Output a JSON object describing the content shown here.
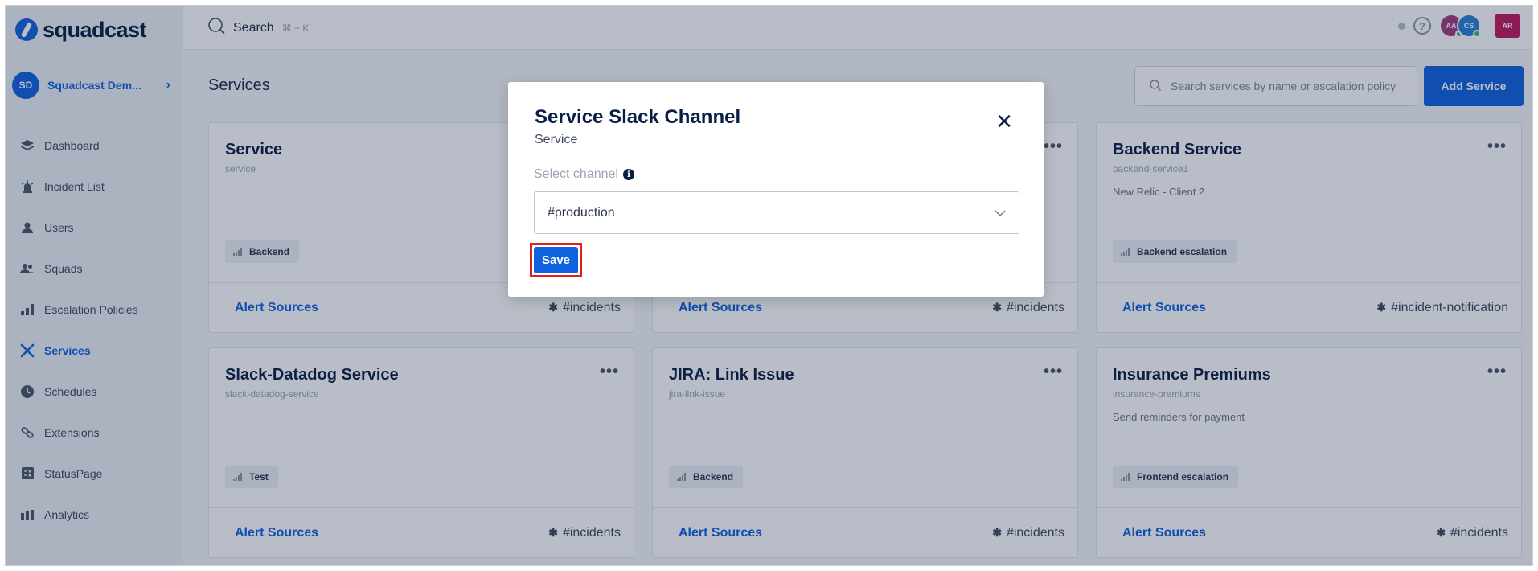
{
  "app": {
    "logo_text": "squadcast"
  },
  "topbar": {
    "search_label": "Search",
    "search_hint": "⌘ + K"
  },
  "org": {
    "initials": "SD",
    "name": "Squadcast Dem..."
  },
  "sidebar": {
    "items": [
      {
        "label": "Dashboard",
        "icon": "layers-icon"
      },
      {
        "label": "Incident List",
        "icon": "siren-icon"
      },
      {
        "label": "Users",
        "icon": "user-icon"
      },
      {
        "label": "Squads",
        "icon": "users-icon"
      },
      {
        "label": "Escalation Policies",
        "icon": "escalation-icon"
      },
      {
        "label": "Services",
        "icon": "services-icon",
        "active": true
      },
      {
        "label": "Schedules",
        "icon": "clock-icon"
      },
      {
        "label": "Extensions",
        "icon": "link-icon"
      },
      {
        "label": "StatusPage",
        "icon": "statuspage-icon"
      },
      {
        "label": "Analytics",
        "icon": "bar-chart-icon"
      }
    ]
  },
  "header": {
    "avatars": [
      "AA",
      "CS"
    ],
    "user_initials": "AR"
  },
  "main": {
    "title": "Services",
    "search_placeholder": "Search services by name or escalation policy",
    "add_button": "Add Service",
    "cards": [
      {
        "title": "Service",
        "slug": "service",
        "desc": "",
        "badge": "Backend",
        "alert_label": "Alert Sources",
        "channel": "#incidents"
      },
      {
        "title": "",
        "slug": "",
        "desc": "",
        "badge": "",
        "alert_label": "Alert Sources",
        "channel": "#incidents"
      },
      {
        "title": "Backend Service",
        "slug": "backend-service1",
        "desc": "New Relic - Client 2",
        "badge": "Backend escalation",
        "alert_label": "Alert Sources",
        "channel": "#incident-notification"
      },
      {
        "title": "Slack-Datadog Service",
        "slug": "slack-datadog-service",
        "desc": "",
        "badge": "Test",
        "alert_label": "Alert Sources",
        "channel": "#incidents"
      },
      {
        "title": "JIRA: Link Issue",
        "slug": "jira-link-issue",
        "desc": "",
        "badge": "Backend",
        "alert_label": "Alert Sources",
        "channel": "#incidents"
      },
      {
        "title": "Insurance Premiums",
        "slug": "insurance-premiums",
        "desc": "Send reminders for payment",
        "badge": "Frontend escalation",
        "alert_label": "Alert Sources",
        "channel": "#incidents"
      }
    ]
  },
  "modal": {
    "title": "Service Slack Channel",
    "subtitle": "Service",
    "field_label": "Select channel",
    "selected_value": "#production",
    "save_label": "Save"
  },
  "colors": {
    "brand": "#0f61dd",
    "highlight": "#e02020"
  }
}
